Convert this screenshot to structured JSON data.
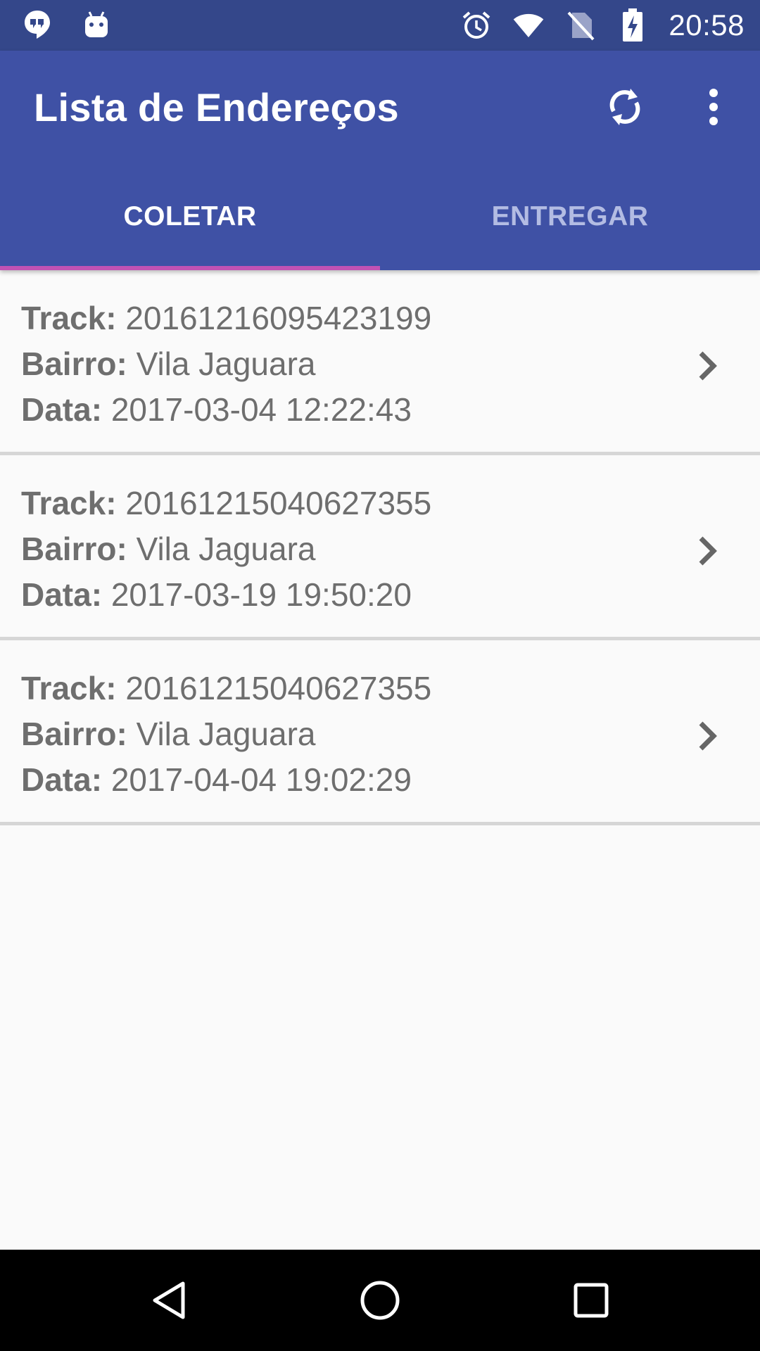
{
  "status_bar": {
    "time": "20:58",
    "icons_left": [
      "hangouts-icon",
      "android-icon"
    ],
    "icons_right": [
      "alarm-icon",
      "wifi-icon",
      "no-sim-icon",
      "battery-charging-icon"
    ]
  },
  "app_bar": {
    "title": "Lista de Endereços",
    "actions": [
      "refresh-icon",
      "overflow-menu-icon"
    ],
    "color": "#3f51a5"
  },
  "tabs": [
    {
      "label": "COLETAR",
      "selected": true
    },
    {
      "label": "ENTREGAR",
      "selected": false
    }
  ],
  "accent_color": "#c152b4",
  "list": {
    "track_label": "Track:",
    "bairro_label": "Bairro:",
    "data_label": "Data:",
    "items": [
      {
        "track": "20161216095423199",
        "bairro": "Vila Jaguara",
        "data": "2017-03-04 12:22:43"
      },
      {
        "track": "20161215040627355",
        "bairro": "Vila Jaguara",
        "data": "2017-03-19 19:50:20"
      },
      {
        "track": "20161215040627355",
        "bairro": "Vila Jaguara",
        "data": "2017-04-04 19:02:29"
      }
    ]
  },
  "nav_bar": {
    "buttons": [
      "back-icon",
      "home-icon",
      "recents-icon"
    ]
  }
}
